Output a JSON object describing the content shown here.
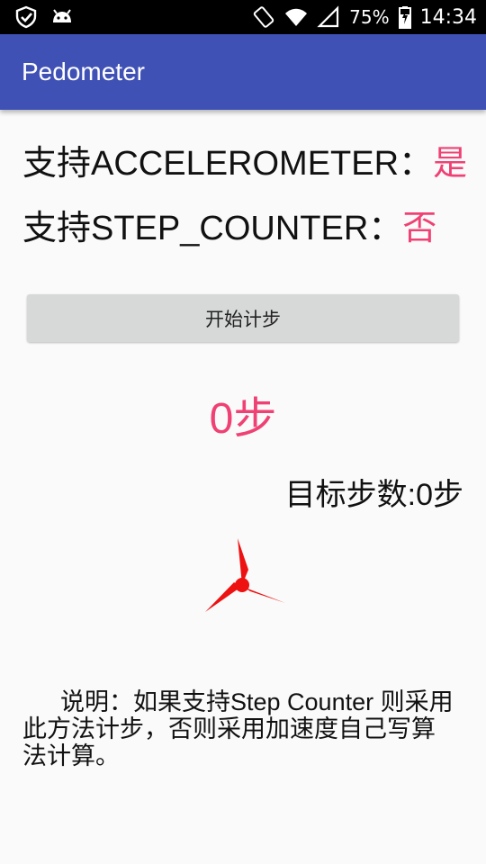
{
  "status_bar": {
    "battery_percent": "75%",
    "time": "14:34",
    "icons": [
      "security-shield-icon",
      "android-icon",
      "rotate-icon",
      "wifi-icon",
      "signal-icon",
      "battery-charging-icon"
    ]
  },
  "app_bar": {
    "title": "Pedometer"
  },
  "support": {
    "accelerometer": {
      "label": "支持ACCELEROMETER：",
      "value": "是"
    },
    "step_counter": {
      "label": "支持STEP_COUNTER：",
      "value": "否"
    }
  },
  "start_button": {
    "label": "开始计步"
  },
  "step_count": "0步",
  "goal": "目标步数:0步",
  "description": "说明：如果支持Step Counter 则采用此方法计步，否则采用加速度自己写算法计算。",
  "colors": {
    "primary": "#3f51b5",
    "accent": "#ef4173",
    "spinner": "#ee1111"
  }
}
